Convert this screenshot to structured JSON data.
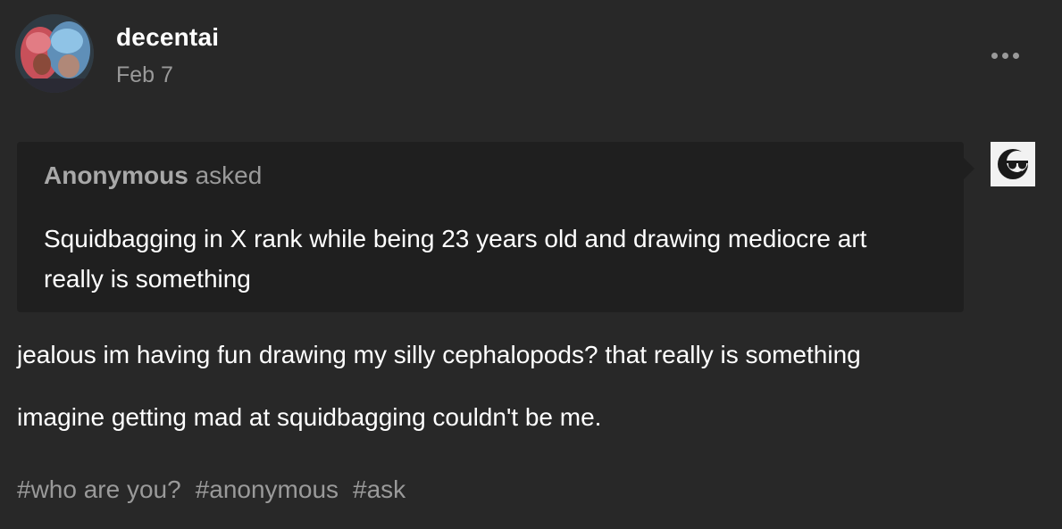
{
  "post": {
    "author": "decentai",
    "date": "Feb 7",
    "more_icon": "more-horizontal-icon"
  },
  "ask": {
    "asker": "Anonymous",
    "verb": "asked",
    "question": "Squidbagging in X rank while being 23 years old and drawing mediocre art really is something",
    "anon_icon": "sunglasses-avatar-icon"
  },
  "answer": {
    "paragraphs": [
      "jealous im having fun drawing my silly cephalopods? that really is something",
      "imagine getting mad at squidbagging couldn't be me."
    ]
  },
  "tags": [
    "#who are you?",
    "#anonymous",
    "#ask"
  ],
  "colors": {
    "background": "#282828",
    "ask_background": "#1f1f1f",
    "muted_text": "#9a9a9a",
    "text": "#ffffff"
  }
}
